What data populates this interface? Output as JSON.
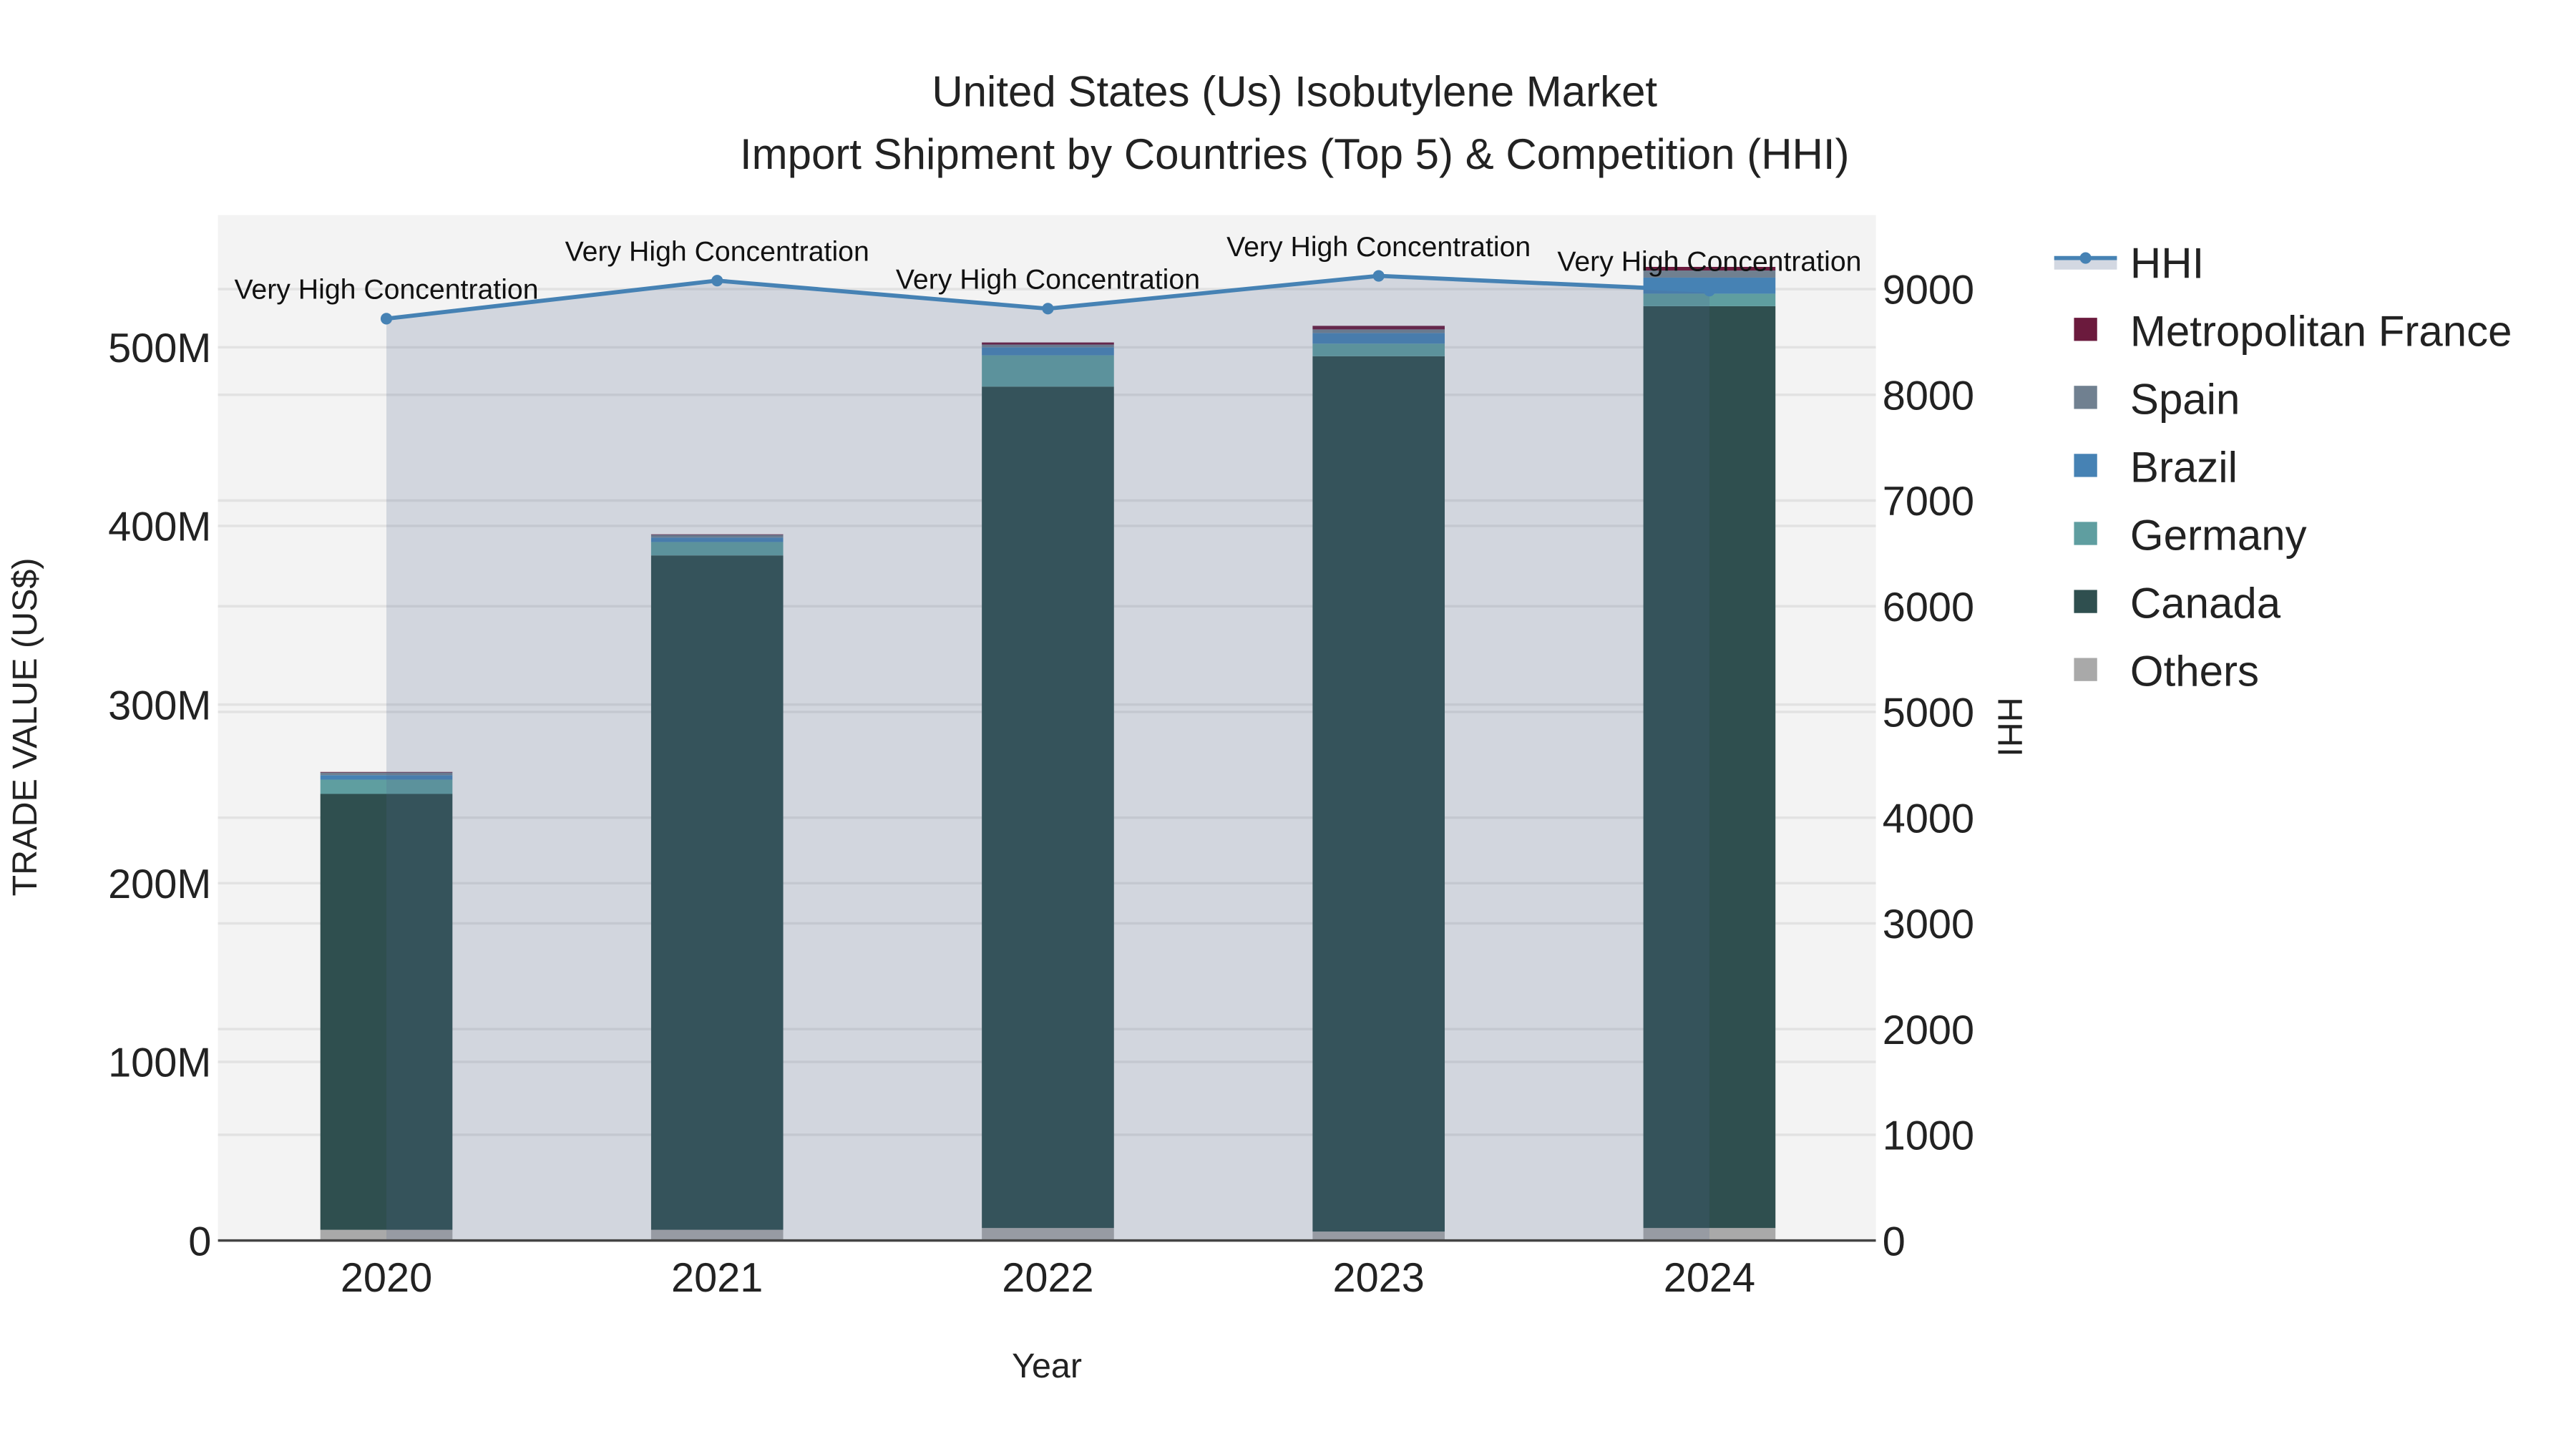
{
  "chart_data": {
    "type": "bar",
    "title": "United States (Us) Isobutylene Market",
    "subtitle": "Import Shipment by Countries (Top 5) & Competition (HHI)",
    "xlabel": "Year",
    "ylabel": "TRADE VALUE (US$)",
    "y2label": "HHI",
    "categories": [
      "2020",
      "2021",
      "2022",
      "2023",
      "2024"
    ],
    "ylim": [
      0,
      574
    ],
    "y_unit": "million US$",
    "y_ticks": [
      0,
      100,
      200,
      300,
      400,
      500
    ],
    "y_tick_labels": [
      "0",
      "100M",
      "200M",
      "300M",
      "400M",
      "500M"
    ],
    "y2lim": [
      0,
      9700
    ],
    "y2_ticks": [
      0,
      1000,
      2000,
      3000,
      4000,
      5000,
      6000,
      7000,
      8000,
      9000
    ],
    "y2_tick_labels": [
      "0",
      "1000",
      "2000",
      "3000",
      "4000",
      "5000",
      "6000",
      "7000",
      "8000",
      "9000"
    ],
    "stacked": true,
    "series": [
      {
        "name": "Others",
        "color": "#a9a9a9",
        "values": [
          6,
          6,
          7,
          5,
          7
        ]
      },
      {
        "name": "Canada",
        "color": "#2f4f4f",
        "values": [
          244,
          377.5,
          471,
          490,
          516
        ]
      },
      {
        "name": "Germany",
        "color": "#5f9ea0",
        "values": [
          8,
          7.5,
          17.5,
          7,
          7
        ]
      },
      {
        "name": "Brazil",
        "color": "#4682b4",
        "values": [
          2.5,
          2.5,
          4.5,
          6,
          9
        ]
      },
      {
        "name": "Spain",
        "color": "#708090",
        "values": [
          1.5,
          1.5,
          1.5,
          2,
          4
        ]
      },
      {
        "name": "Metropolitan France",
        "color": "#6b1a3d",
        "values": [
          0.3,
          0.3,
          1.2,
          2,
          2
        ]
      }
    ],
    "line": {
      "name": "HHI",
      "color": "#4682b4",
      "values": [
        8720,
        9080,
        8815,
        9125,
        8985
      ],
      "annotations": [
        "Very High Concentration",
        "Very High Concentration",
        "Very High Concentration",
        "Very High Concentration",
        "Very High Concentration"
      ]
    },
    "legend": {
      "position": "right",
      "items": [
        "HHI",
        "Metropolitan France",
        "Spain",
        "Brazil",
        "Germany",
        "Canada",
        "Others"
      ]
    },
    "grid": true
  }
}
